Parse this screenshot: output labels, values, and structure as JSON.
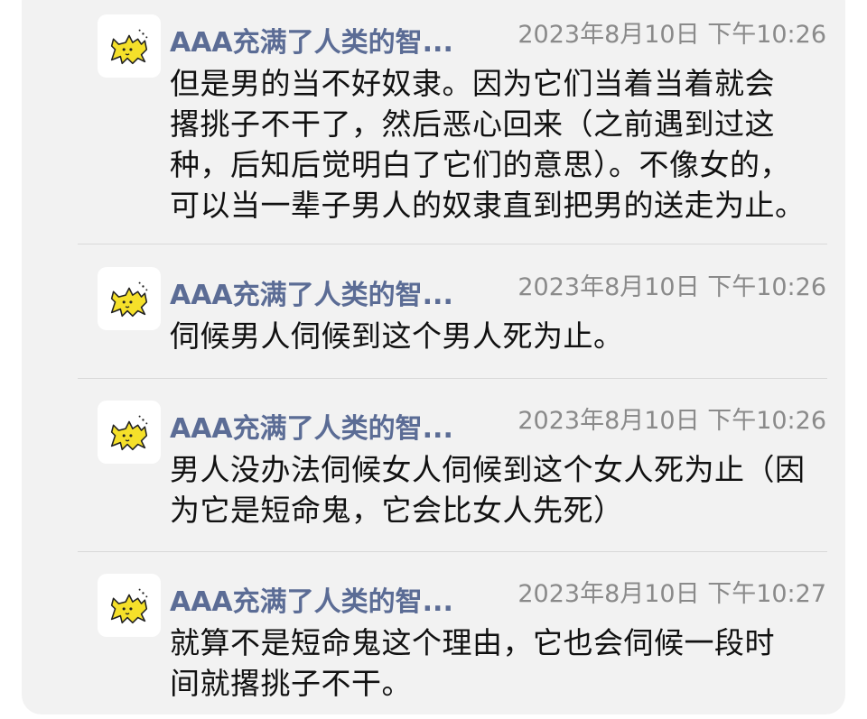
{
  "messages": [
    {
      "sender": "AAA充满了人类的智...",
      "time": "2023年8月10日 下午10:26",
      "text_lines": [
        "但是男的当不好奴隶。因为它们当着当着就会",
        "撂挑子不干了，然后恶心回来（之前遇到过这",
        "种，后知后觉明白了它们的意思）。不像女的，",
        "可以当一辈子男人的奴隶直到把男的送走为止。"
      ]
    },
    {
      "sender": "AAA充满了人类的智...",
      "time": "2023年8月10日 下午10:26",
      "text_lines": [
        "伺候男人伺候到这个男人死为止。"
      ]
    },
    {
      "sender": "AAA充满了人类的智...",
      "time": "2023年8月10日 下午10:26",
      "text_lines": [
        "男人没办法伺候女人伺候到这个女人死为止（因",
        "为它是短命鬼，它会比女人先死）"
      ]
    },
    {
      "sender": "AAA充满了人类的智...",
      "time": "2023年8月10日 下午10:27",
      "text_lines": [
        "就算不是短命鬼这个理由，它也会伺候一段时",
        "间就撂挑子不干。"
      ]
    }
  ],
  "colors": {
    "card_bg": "#f2f2f2",
    "name": "#5b6c95",
    "time": "#8a8a8a",
    "text": "#111111",
    "avatar_cat": "#f5e02a"
  },
  "icons": {
    "avatar": "yellow-cat-icon"
  }
}
